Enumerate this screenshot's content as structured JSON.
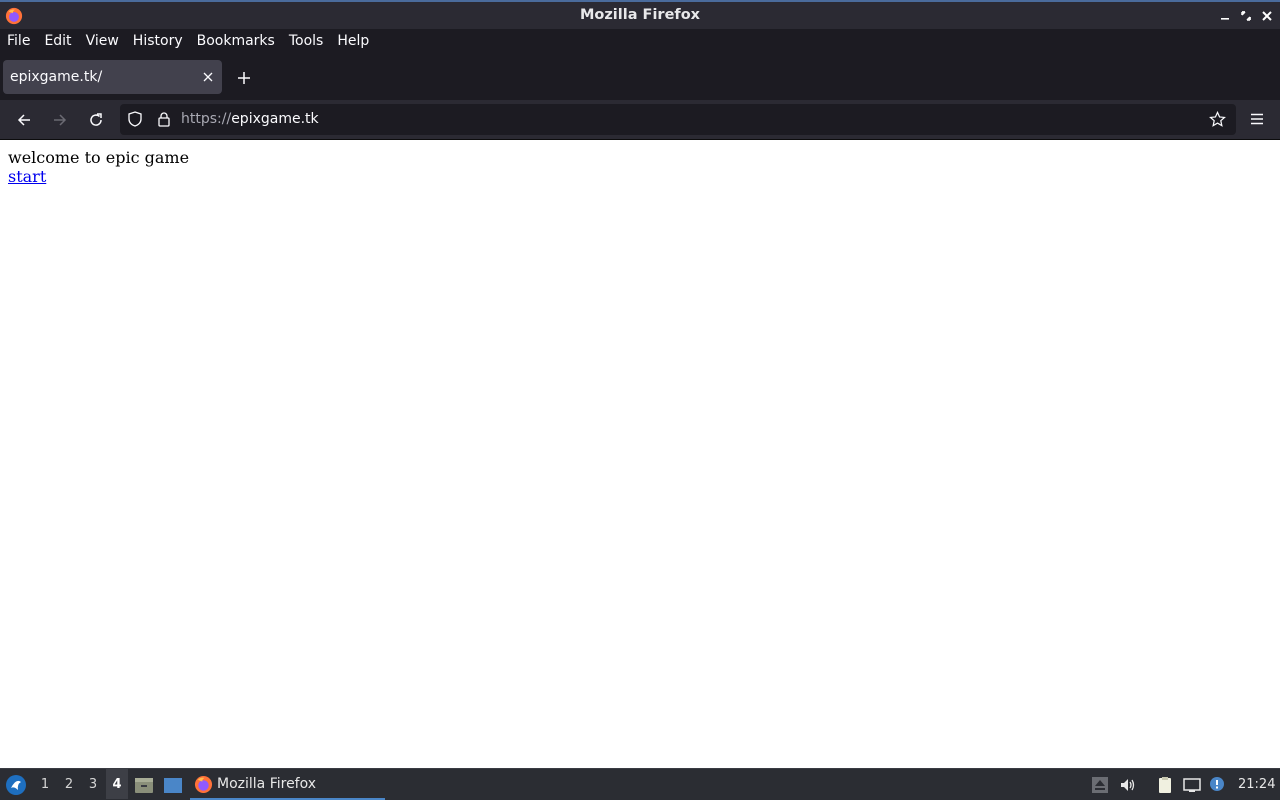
{
  "window": {
    "title": "Mozilla Firefox"
  },
  "menubar": {
    "items": [
      "File",
      "Edit",
      "View",
      "History",
      "Bookmarks",
      "Tools",
      "Help"
    ]
  },
  "tabs": [
    {
      "label": "epixgame.tk/",
      "active": true
    }
  ],
  "navbar": {
    "url_scheme": "https://",
    "url_host": "epixgame.tk"
  },
  "page": {
    "welcome_text": "welcome to epic game",
    "start_link": "start"
  },
  "taskbar": {
    "workspaces": [
      "1",
      "2",
      "3",
      "4"
    ],
    "active_workspace": "4",
    "task_label": "Mozilla Firefox",
    "clock": "21:24"
  },
  "colors": {
    "chrome_dark": "#1c1b22",
    "toolbar": "#2b2a33",
    "tab_active": "#42414d",
    "link": "#0000ee",
    "taskbar_accent": "#4a86c8"
  },
  "icons": [
    "firefox-icon",
    "minimize-icon",
    "maximize-icon",
    "close-icon",
    "tab-close-icon",
    "plus-icon",
    "back-arrow-icon",
    "forward-arrow-icon",
    "reload-icon",
    "shield-icon",
    "lock-icon",
    "star-icon",
    "hamburger-menu-icon",
    "start-menu-icon",
    "file-manager-icon",
    "desktop-icon",
    "eject-icon",
    "speaker-icon",
    "clipboard-icon",
    "network-icon",
    "notification-icon"
  ]
}
